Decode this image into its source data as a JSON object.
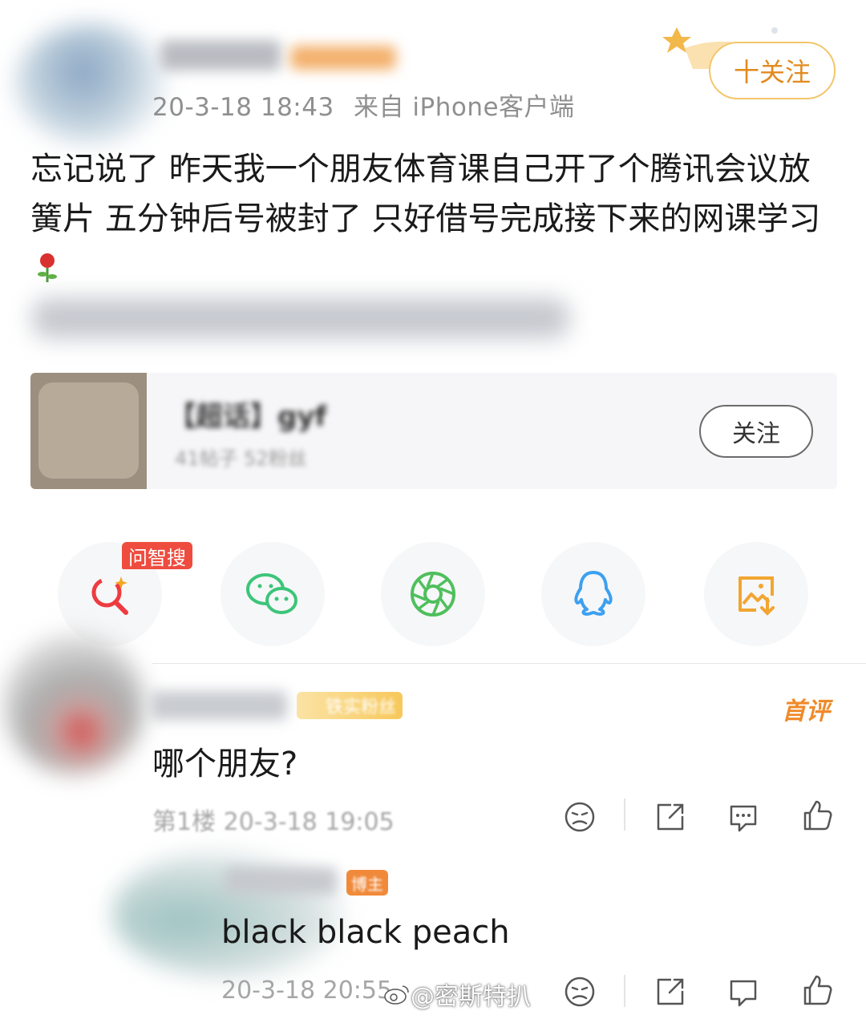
{
  "post": {
    "meta": "20-3-18 18:43",
    "source": "来自 iPhone客户端",
    "follow_label": "十关注",
    "text": "忘记说了 昨天我一个朋友体育课自己开了个腾讯会议放簧片 五分钟后号被封了 只好借号完成接下来的网课学习",
    "emoji_icon": "rose-icon"
  },
  "card": {
    "title": "【超话】gyf",
    "subtitle": "41帖子 52粉丝",
    "follow_label": "关注"
  },
  "share": {
    "search_tag": "问智搜",
    "items": [
      "search-icon",
      "wechat-icon",
      "moments-icon",
      "qq-icon",
      "save-image-icon"
    ]
  },
  "comment": {
    "badge": "铁实粉丝",
    "first_label": "首评",
    "text": "哪个朋友?",
    "floor": "第1楼 20-3-18 19:05"
  },
  "reply": {
    "badge": "博主",
    "text": "black black peach",
    "time": "20-3-18 20:55",
    "watermark": "@密斯特扒"
  },
  "colors": {
    "accent_orange": "#e38a1e",
    "follow_border": "#f3c66a",
    "search_tag_red": "#ee4c3f",
    "wechat_green": "#3cc57a",
    "moments_green": "#4fbf5c",
    "qq_blue": "#3da0f0",
    "save_orange": "#f2a531"
  }
}
